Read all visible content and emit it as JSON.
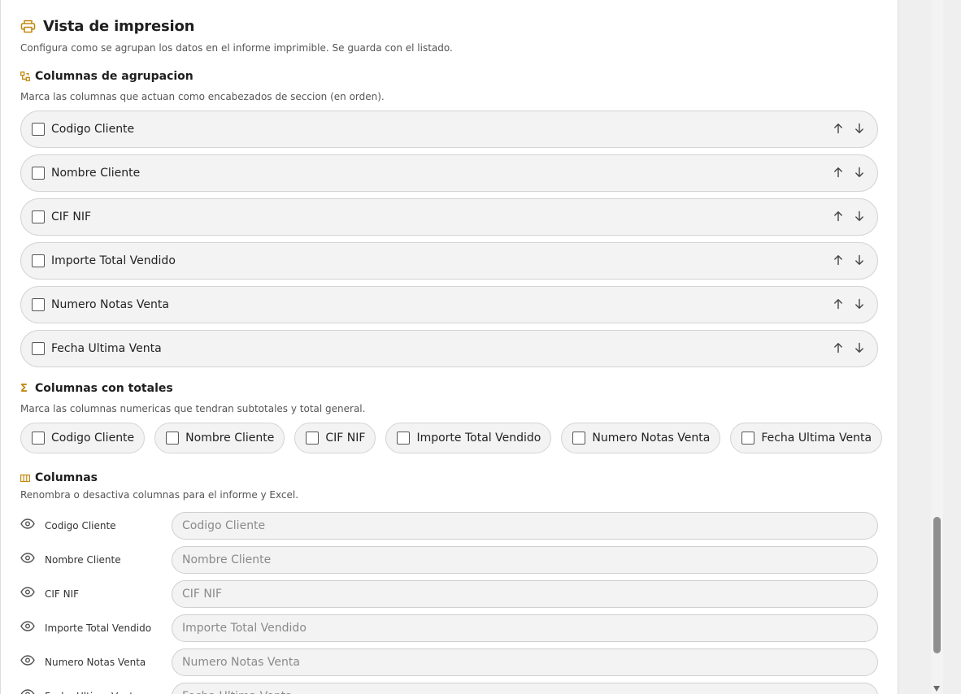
{
  "header": {
    "title": "Vista de impresion",
    "description": "Configura como se agrupan los datos en el informe imprimible. Se guarda con el listado."
  },
  "grouping": {
    "title": "Columnas de agrupacion",
    "description": "Marca las columnas que actuan como encabezados de seccion (en orden).",
    "items": [
      {
        "label": "Codigo Cliente",
        "checked": false
      },
      {
        "label": "Nombre Cliente",
        "checked": false
      },
      {
        "label": "CIF NIF",
        "checked": false
      },
      {
        "label": "Importe Total Vendido",
        "checked": false
      },
      {
        "label": "Numero Notas Venta",
        "checked": false
      },
      {
        "label": "Fecha Ultima Venta",
        "checked": false
      }
    ]
  },
  "totals": {
    "title": "Columnas con totales",
    "description": "Marca las columnas numericas que tendran subtotales y total general.",
    "items": [
      {
        "label": "Codigo Cliente",
        "checked": false
      },
      {
        "label": "Nombre Cliente",
        "checked": false
      },
      {
        "label": "CIF NIF",
        "checked": false
      },
      {
        "label": "Importe Total Vendido",
        "checked": false
      },
      {
        "label": "Numero Notas Venta",
        "checked": false
      },
      {
        "label": "Fecha Ultima Venta",
        "checked": false
      }
    ]
  },
  "columns": {
    "title": "Columnas",
    "description": "Renombra o desactiva columnas para el informe y Excel.",
    "items": [
      {
        "label": "Codigo Cliente",
        "placeholder": "Codigo Cliente",
        "value": ""
      },
      {
        "label": "Nombre Cliente",
        "placeholder": "Nombre Cliente",
        "value": ""
      },
      {
        "label": "CIF NIF",
        "placeholder": "CIF NIF",
        "value": ""
      },
      {
        "label": "Importe Total Vendido",
        "placeholder": "Importe Total Vendido",
        "value": ""
      },
      {
        "label": "Numero Notas Venta",
        "placeholder": "Numero Notas Venta",
        "value": ""
      },
      {
        "label": "Fecha Ultima Venta",
        "placeholder": "Fecha Ultima Venta",
        "value": ""
      }
    ]
  },
  "colors": {
    "accent": "#c08a12",
    "row_bg": "#f3f3f3",
    "border": "#d4d4d4"
  },
  "icons": {
    "header": "printer-icon",
    "grouping": "group-columns-icon",
    "totals": "sigma-icon",
    "columns": "columns-icon",
    "visibility": "eye-icon",
    "move_up": "arrow-up-icon",
    "move_down": "arrow-down-icon"
  }
}
